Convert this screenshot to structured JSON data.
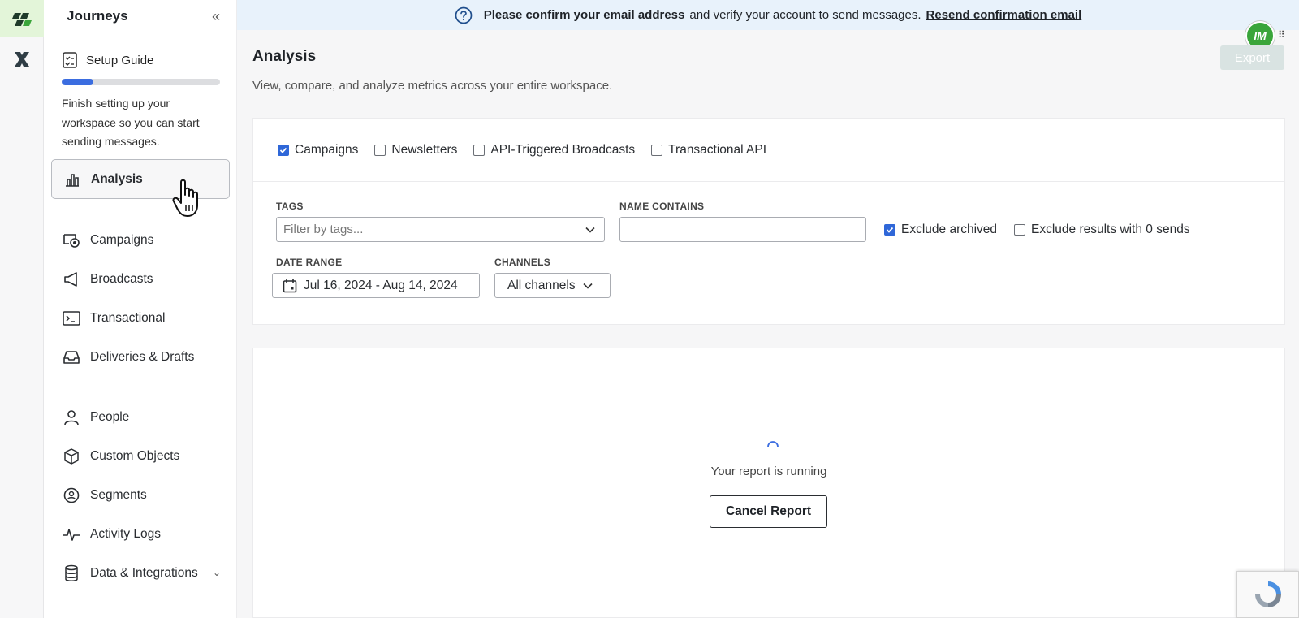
{
  "sidebar": {
    "title": "Journeys",
    "setup": {
      "label": "Setup Guide",
      "progress": 0.2,
      "description": "Finish setting up your workspace so you can start sending messages."
    },
    "items": [
      {
        "label": "Analysis",
        "icon": "bar-chart-icon",
        "active": true
      },
      {
        "label": "Campaigns",
        "icon": "campaign-icon"
      },
      {
        "label": "Broadcasts",
        "icon": "megaphone-icon"
      },
      {
        "label": "Transactional",
        "icon": "terminal-icon"
      },
      {
        "label": "Deliveries & Drafts",
        "icon": "inbox-icon"
      },
      {
        "label": "People",
        "icon": "person-icon"
      },
      {
        "label": "Custom Objects",
        "icon": "cube-icon"
      },
      {
        "label": "Segments",
        "icon": "segments-icon"
      },
      {
        "label": "Activity Logs",
        "icon": "pulse-icon"
      },
      {
        "label": "Data & Integrations",
        "icon": "database-icon"
      }
    ]
  },
  "banner": {
    "bold_text": "Please confirm your email address",
    "text": "and verify your account to send messages.",
    "link": "Resend confirmation email"
  },
  "user": {
    "initials": "IM"
  },
  "main": {
    "title": "Analysis",
    "subtitle": "View, compare, and analyze metrics across your entire workspace.",
    "export_label": "Export",
    "types": [
      {
        "label": "Campaigns",
        "checked": true
      },
      {
        "label": "Newsletters",
        "checked": false
      },
      {
        "label": "API-Triggered Broadcasts",
        "checked": false
      },
      {
        "label": "Transactional API",
        "checked": false
      }
    ],
    "tags_label": "TAGS",
    "tags_placeholder": "Filter by tags...",
    "name_label": "NAME CONTAINS",
    "name_value": "",
    "exclude_archived": "Exclude archived",
    "exclude_zero": "Exclude results with 0 sends",
    "date_label": "DATE RANGE",
    "date_value": "Jul 16, 2024 - Aug 14, 2024",
    "channels_label": "CHANNELS",
    "channels_value": "All channels",
    "report_status": "Your report is running",
    "cancel_label": "Cancel Report"
  },
  "colors": {
    "accent": "#2f67d8",
    "banner_bg": "#e8f2fb",
    "brand_green": "#3aa53a"
  }
}
